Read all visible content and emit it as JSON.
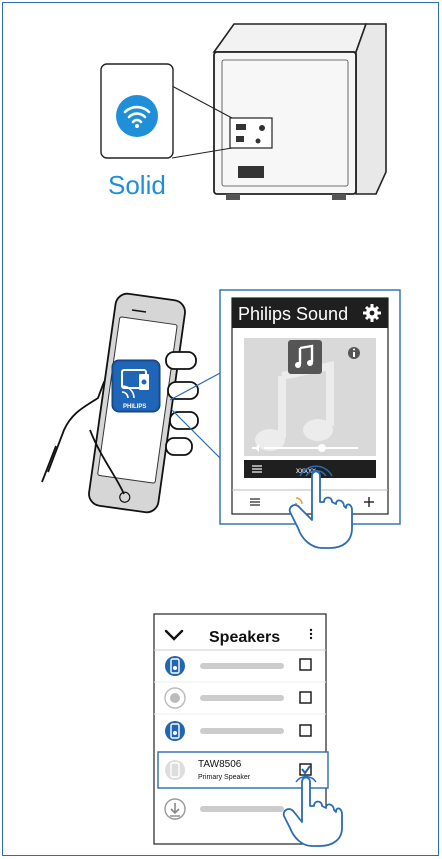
{
  "step1": {
    "mode_label": "Solid",
    "icons": [
      "wifi-icon",
      "subwoofer-illustration"
    ]
  },
  "step2": {
    "app_title": "Philips Sound",
    "logo_text": "PHILIPS",
    "now_playing": "xxxxx",
    "icons": [
      "gear-icon",
      "music-note-icon",
      "info-icon",
      "cast-icon",
      "plus-icon",
      "hand-pointer-icon"
    ]
  },
  "step3": {
    "header_title": "Speakers",
    "speaker_model": "TAW8506",
    "speaker_role": "Primary Speaker",
    "icons": [
      "chevron-down-icon",
      "more-vertical-icon",
      "speaker-icon",
      "checkbox-icon",
      "download-icon",
      "hand-pointer-icon"
    ]
  },
  "colors": {
    "frame": "#2b6cb5",
    "accent": "#1e8fd8",
    "app_dark": "#1f1f1f",
    "speaker_blue": "#2266b0"
  }
}
